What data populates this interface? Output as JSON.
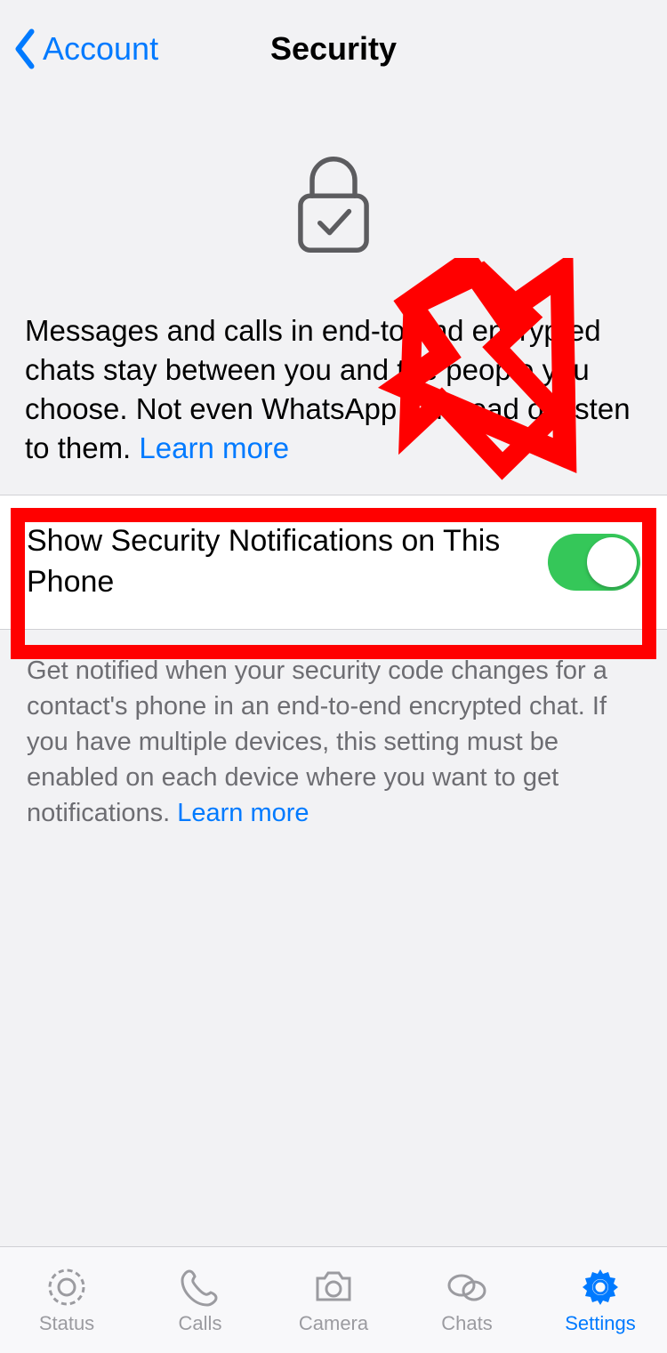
{
  "nav": {
    "back_label": "Account",
    "title": "Security"
  },
  "description": {
    "body": "Messages and calls in end-to-end encrypted chats stay between you and the people you choose. Not even WhatsApp can read or listen to them. ",
    "learn_more": "Learn more"
  },
  "setting": {
    "label": "Show Security Notifications on This Phone",
    "enabled": true
  },
  "footer": {
    "body": "Get notified when your security code changes for a contact's phone in an end-to-end encrypted chat. If you have multiple devices, this setting must be enabled on each device where you want to get notifications. ",
    "learn_more": "Learn more"
  },
  "tabs": {
    "items": [
      {
        "label": "Status",
        "active": false
      },
      {
        "label": "Calls",
        "active": false
      },
      {
        "label": "Camera",
        "active": false
      },
      {
        "label": "Chats",
        "active": false
      },
      {
        "label": "Settings",
        "active": true
      }
    ]
  },
  "annotation": {
    "type": "highlight-arrow",
    "target": "show-security-notifications-toggle",
    "color": "#ff0000"
  }
}
